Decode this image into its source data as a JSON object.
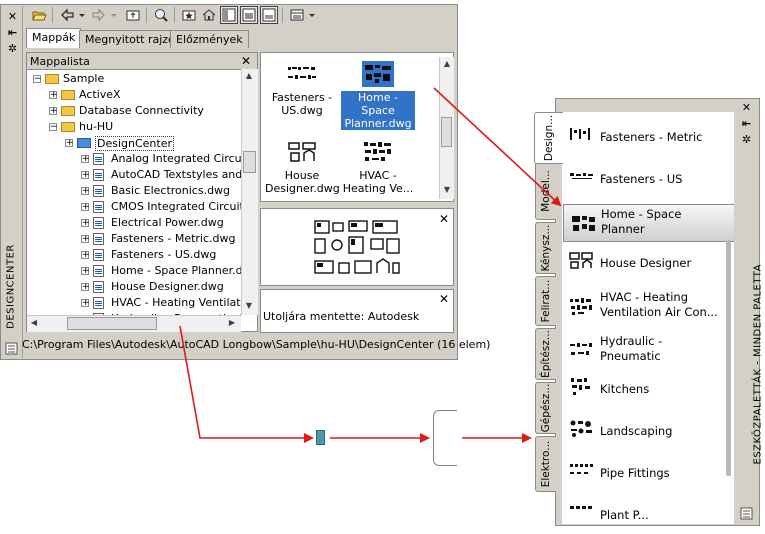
{
  "designcenter": {
    "title": "DESIGNCENTER",
    "tabs": [
      {
        "label": "Mappák"
      },
      {
        "label": "Megnyitott rajzok"
      },
      {
        "label": "Előzmények"
      }
    ],
    "folder_list": {
      "title": "Mappalista",
      "tree": [
        {
          "label": "Sample",
          "kind": "folder",
          "expanded": true
        },
        {
          "label": "ActiveX",
          "kind": "folder"
        },
        {
          "label": "Database Connectivity",
          "kind": "folder"
        },
        {
          "label": "hu-HU",
          "kind": "folder",
          "expanded": true
        },
        {
          "label": "DesignCenter",
          "kind": "folder",
          "selected": true
        },
        {
          "label": "Analog Integrated Circuits",
          "kind": "dwg"
        },
        {
          "label": "AutoCAD Textstyles and",
          "kind": "dwg"
        },
        {
          "label": "Basic Electronics.dwg",
          "kind": "dwg"
        },
        {
          "label": "CMOS Integrated Circuits",
          "kind": "dwg"
        },
        {
          "label": "Electrical Power.dwg",
          "kind": "dwg"
        },
        {
          "label": "Fasteners - Metric.dwg",
          "kind": "dwg"
        },
        {
          "label": "Fasteners - US.dwg",
          "kind": "dwg"
        },
        {
          "label": "Home - Space Planner.d",
          "kind": "dwg"
        },
        {
          "label": "House Designer.dwg",
          "kind": "dwg"
        },
        {
          "label": "HVAC - Heating Ventilatio",
          "kind": "dwg"
        },
        {
          "label": "Hydraulic - Pneumatic.dwg",
          "kind": "dwg"
        }
      ]
    },
    "palette_items": [
      {
        "line1": "Fasteners -",
        "line2": "US.dwg",
        "selected": false
      },
      {
        "line1": "Home - Space",
        "line2": "Planner.dwg",
        "selected": true
      },
      {
        "line1": "House",
        "line2": "Designer.dwg",
        "selected": false
      },
      {
        "line1": "HVAC -",
        "line2": "Heating Ve...",
        "selected": false
      }
    ],
    "description": "Utoljára mentette: Autodesk",
    "status_path": "C:\\Program Files\\Autodesk\\AutoCAD Longbow\\Sample\\hu-HU\\DesignCenter (16 elem)",
    "close_glyph": "✕",
    "pin_glyph": "⇤",
    "props_glyph": "✲"
  },
  "tool_palette": {
    "title": "ESZKÖZPALETTÁK - MINDEN PALETTA",
    "tabs": [
      {
        "label": "Design...",
        "active": true
      },
      {
        "label": "Model..."
      },
      {
        "label": "Kénysz..."
      },
      {
        "label": "Felirat..."
      },
      {
        "label": "Építész..."
      },
      {
        "label": "Gépész..."
      },
      {
        "label": "Elektro..."
      }
    ],
    "items": [
      {
        "label1": "Fasteners - Metric",
        "label2": ""
      },
      {
        "label1": "Fasteners - US",
        "label2": ""
      },
      {
        "label1": "Home - Space",
        "label2": "Planner",
        "selected": true
      },
      {
        "label1": "House Designer",
        "label2": ""
      },
      {
        "label1": "HVAC - Heating",
        "label2": "Ventilation Air Con..."
      },
      {
        "label1": "Hydraulic -",
        "label2": "Pneumatic"
      },
      {
        "label1": "Kitchens",
        "label2": ""
      },
      {
        "label1": "Landscaping",
        "label2": ""
      },
      {
        "label1": "Pipe Fittings",
        "label2": ""
      },
      {
        "label1": "Plant P...",
        "label2": ""
      }
    ]
  },
  "colors": {
    "arrow": "#e01818",
    "selection": "#3173c6",
    "chrome": "#d4d0c8"
  },
  "icons": {
    "open": "folder-open-icon",
    "back": "back-arrow-icon",
    "forward": "forward-arrow-icon",
    "up": "up-folder-icon",
    "search": "search-icon",
    "favorites": "favorites-icon",
    "home": "home-icon",
    "tree_toggle": "tree-toggle-icon",
    "preview": "preview-icon",
    "description": "description-icon",
    "views": "views-icon"
  }
}
